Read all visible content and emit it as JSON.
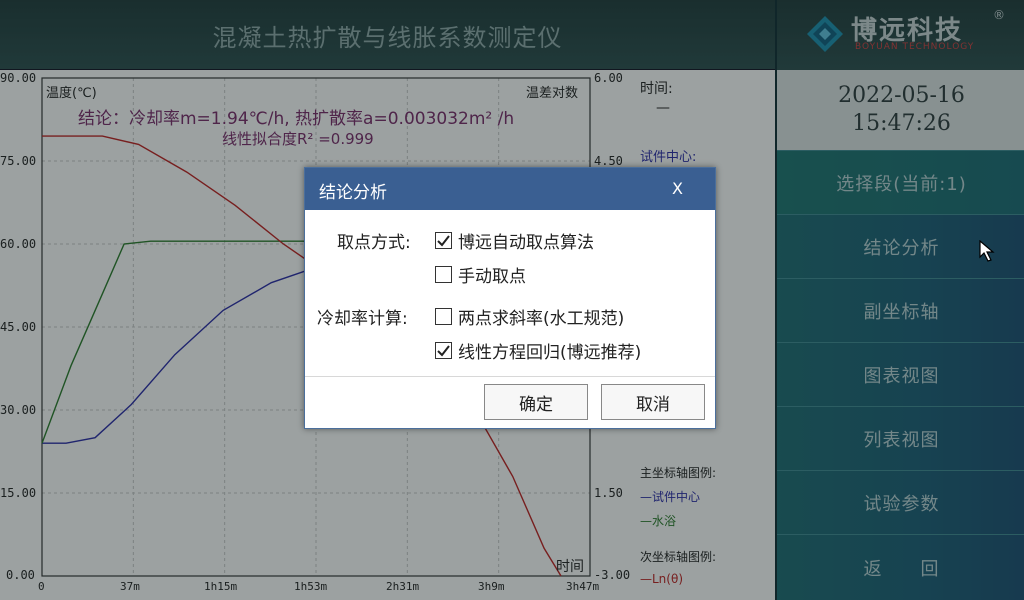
{
  "header": {
    "title": "混凝土热扩散与线胀系数测定仪"
  },
  "logo": {
    "brand": "博远科技",
    "reg": "®",
    "brand_en": "BOYUAN TECHNOLOGY"
  },
  "datetime": {
    "date": "2022-05-16",
    "time": "15:47:26"
  },
  "sidebar": {
    "items": [
      {
        "label": "选择段(当前:1)"
      },
      {
        "label": "结论分析"
      },
      {
        "label": "副坐标轴"
      },
      {
        "label": "图表视图"
      },
      {
        "label": "列表视图"
      },
      {
        "label": "试验参数"
      },
      {
        "label": "返　　回"
      }
    ]
  },
  "chart": {
    "left_axis_label": "温度(℃)",
    "right_axis_label": "温差对数",
    "x_axis_label": "时间",
    "result_line1": "结论：冷却率m=1.94℃/h, 热扩散率a=0.003032m² /h",
    "result_line2": "线性拟合度R² =0.999",
    "y_ticks": [
      "90.00",
      "75.00",
      "60.00",
      "45.00",
      "30.00",
      "15.00",
      "0.00"
    ],
    "y2_ticks": [
      "6.00",
      "4.50",
      "1.50",
      "-3.00"
    ],
    "x_ticks": [
      "0",
      "37m",
      "1h15m",
      "1h53m",
      "2h31m",
      "3h9m",
      "3h47m"
    ]
  },
  "legend": {
    "time_label": "时间:",
    "time_value": "—",
    "sample_center_label": "试件中心:",
    "primary_title": "主坐标轴图例:",
    "primary_items": [
      {
        "label": "—试件中心",
        "color": "#2a2aa8"
      },
      {
        "label": "—水浴",
        "color": "#2a7a2a"
      }
    ],
    "secondary_title": "次坐标轴图例:",
    "secondary_items": [
      {
        "label": "—Ln(θ)",
        "color": "#c02020"
      }
    ]
  },
  "dialog": {
    "title": "结论分析",
    "close": "X",
    "pick_method_label": "取点方式:",
    "pick_options": [
      {
        "label": "博远自动取点算法",
        "checked": true
      },
      {
        "label": "手动取点",
        "checked": false
      }
    ],
    "cooling_rate_label": "冷却率计算:",
    "cooling_options": [
      {
        "label": "两点求斜率(水工规范)",
        "checked": false
      },
      {
        "label": "线性方程回归(博远推荐)",
        "checked": true
      }
    ],
    "ok_label": "确定",
    "cancel_label": "取消"
  },
  "colors": {
    "blue_series": "#2a2aa8",
    "green_series": "#2a7a2a",
    "red_series": "#c02020",
    "dialog_titlebar": "#3a5f92",
    "sidebar": "#1a5a6e"
  },
  "chart_data": {
    "type": "line",
    "xlabel": "时间",
    "ylabel": "温度(℃)",
    "y2label": "温差对数",
    "ylim": [
      0,
      90
    ],
    "x_ticks": [
      "0",
      "37m",
      "1h15m",
      "1h53m",
      "2h31m",
      "3h9m",
      "3h47m"
    ],
    "x_range_minutes": [
      0,
      227
    ],
    "grid": true,
    "series": [
      {
        "name": "试件中心",
        "axis": "primary",
        "color": "#2a2aa8",
        "points": [
          [
            0,
            24
          ],
          [
            10,
            24
          ],
          [
            22,
            25
          ],
          [
            37,
            31
          ],
          [
            55,
            40
          ],
          [
            75,
            48
          ],
          [
            95,
            53
          ],
          [
            115,
            56
          ],
          [
            130,
            57
          ]
        ]
      },
      {
        "name": "水浴",
        "axis": "primary",
        "color": "#2a7a2a",
        "points": [
          [
            0,
            24
          ],
          [
            12,
            38
          ],
          [
            25,
            51
          ],
          [
            34,
            60
          ],
          [
            45,
            60.5
          ],
          [
            130,
            60.5
          ]
        ]
      },
      {
        "name": "Ln(θ)",
        "axis": "secondary",
        "color": "#c02020",
        "points": [
          [
            0,
            4.95
          ],
          [
            25,
            4.95
          ],
          [
            40,
            4.8
          ],
          [
            60,
            4.3
          ],
          [
            80,
            3.7
          ],
          [
            100,
            3.0
          ],
          [
            120,
            2.4
          ],
          [
            140,
            1.8
          ],
          [
            160,
            1.0
          ],
          [
            178,
            0.1
          ],
          [
            195,
            -1.2
          ],
          [
            208,
            -2.5
          ],
          [
            215,
            -3.0
          ]
        ]
      }
    ]
  }
}
